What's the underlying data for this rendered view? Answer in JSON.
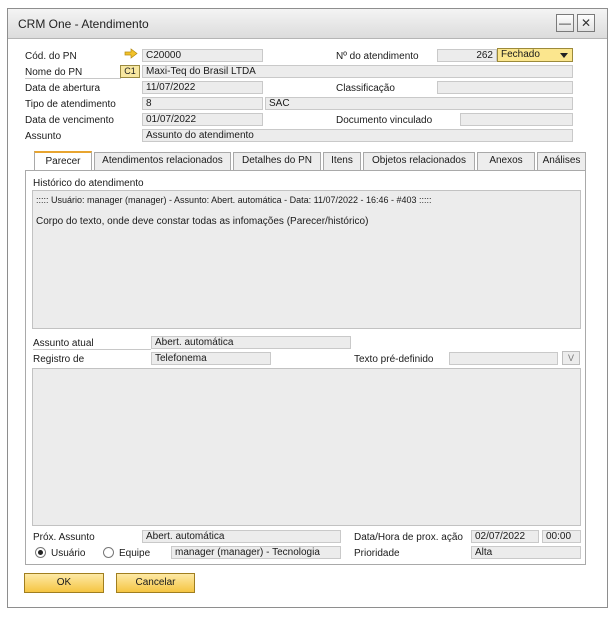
{
  "window": {
    "title": "CRM One - Atendimento",
    "minimize_glyph": "—",
    "close_glyph": "✕"
  },
  "header": {
    "cod_pn_label": "Cód. do PN",
    "cod_pn_value": "C20000",
    "nome_pn_label": "Nome do PN",
    "nome_pn_badge": "C1",
    "nome_pn_value": "Maxi-Teq do Brasil LTDA",
    "data_abertura_label": "Data de abertura",
    "data_abertura_value": "11/07/2022",
    "tipo_label": "Tipo de atendimento",
    "tipo_code": "8",
    "tipo_value": "SAC",
    "data_venc_label": "Data de vencimento",
    "data_venc_value": "01/07/2022",
    "assunto_label": "Assunto",
    "assunto_value": "Assunto do atendimento",
    "num_atend_label": "Nº do atendimento",
    "num_atend_value": "262",
    "status_value": "Fechado",
    "classificacao_label": "Classificação",
    "classificacao_value": "",
    "doc_vinculado_label": "Documento vinculado",
    "doc_vinculado_value": ""
  },
  "tabs": [
    {
      "label": "Parecer"
    },
    {
      "label": "Atendimentos relacionados"
    },
    {
      "label": "Detalhes do PN"
    },
    {
      "label": "Itens"
    },
    {
      "label": "Objetos relacionados"
    },
    {
      "label": "Anexos"
    },
    {
      "label": "Análises"
    }
  ],
  "parecer": {
    "historico_label": "Histórico do atendimento",
    "historico_line1": "::::: Usuário: manager (manager) - Assunto: Abert. automática - Data: 11/07/2022 - 16:46 - #403 :::::",
    "historico_line2": "Corpo do texto, onde deve constar todas as infomações (Parecer/histórico)",
    "assunto_atual_label": "Assunto atual",
    "assunto_atual_value": "Abert. automática",
    "registro_label": "Registro de",
    "registro_value": "Telefonema",
    "texto_predef_label": "Texto pré-definido",
    "texto_predef_value": "",
    "texto_predef_btn": "V",
    "prox_assunto_label": "Próx. Assunto",
    "prox_assunto_value": "Abert. automática",
    "data_hora_label": "Data/Hora de prox. ação",
    "data_value": "02/07/2022",
    "hora_value": "00:00",
    "radio_usuario": "Usuário",
    "radio_equipe": "Equipe",
    "responsavel_value": "manager (manager) - Tecnologia",
    "prioridade_label": "Prioridade",
    "prioridade_value": "Alta"
  },
  "footer": {
    "ok_label": "OK",
    "cancel_label": "Cancelar"
  },
  "colors": {
    "accent": "#e8a530",
    "button": "#f5c542",
    "field": "#ececec"
  }
}
